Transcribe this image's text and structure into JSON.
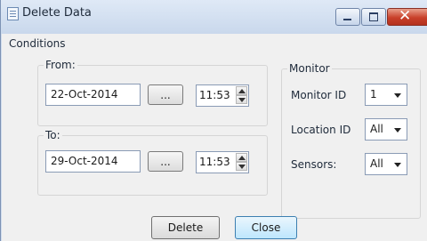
{
  "window": {
    "title": "Delete Data",
    "icons": {
      "app": "table-window-icon",
      "minimize": "minimize-icon",
      "maximize": "maximize-icon",
      "close": "close-icon"
    },
    "close_color": "#c8402a"
  },
  "conditions": {
    "label": "Conditions",
    "from": {
      "label": "From:",
      "date": "22-Oct-2014",
      "ellipsis": "...",
      "time": "11:53"
    },
    "to": {
      "label": "To:",
      "date": "29-Oct-2014",
      "ellipsis": "...",
      "time": "11:53"
    }
  },
  "monitor": {
    "label": "Monitor",
    "monitor_id": {
      "label": "Monitor ID",
      "value": "1"
    },
    "location_id": {
      "label": "Location ID",
      "value": "All"
    },
    "sensors": {
      "label": "Sensors:",
      "value": "All"
    }
  },
  "buttons": {
    "delete": "Delete",
    "close": "Close"
  }
}
